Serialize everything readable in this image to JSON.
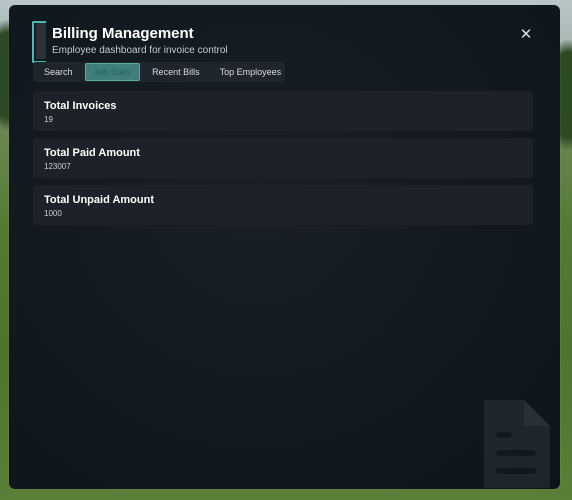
{
  "app": {
    "title": "Billing Management",
    "subtitle": "Employee dashboard for invoice control"
  },
  "close": {
    "icon": "close-icon"
  },
  "tabs": [
    {
      "label": "Search",
      "active": false
    },
    {
      "label": "Job Stats",
      "active": true
    },
    {
      "label": "Recent Bills",
      "active": false
    },
    {
      "label": "Top Employees",
      "active": false
    }
  ],
  "stats": [
    {
      "label": "Total Invoices",
      "value": "19"
    },
    {
      "label": "Total Paid Amount",
      "value": "123007"
    },
    {
      "label": "Total Unpaid Amount",
      "value": "1000"
    }
  ],
  "colors": {
    "accent": "#4fb8b3",
    "panel": "#121a1f",
    "card": "#1c2227"
  },
  "watermark": {
    "icon": "document-icon"
  }
}
